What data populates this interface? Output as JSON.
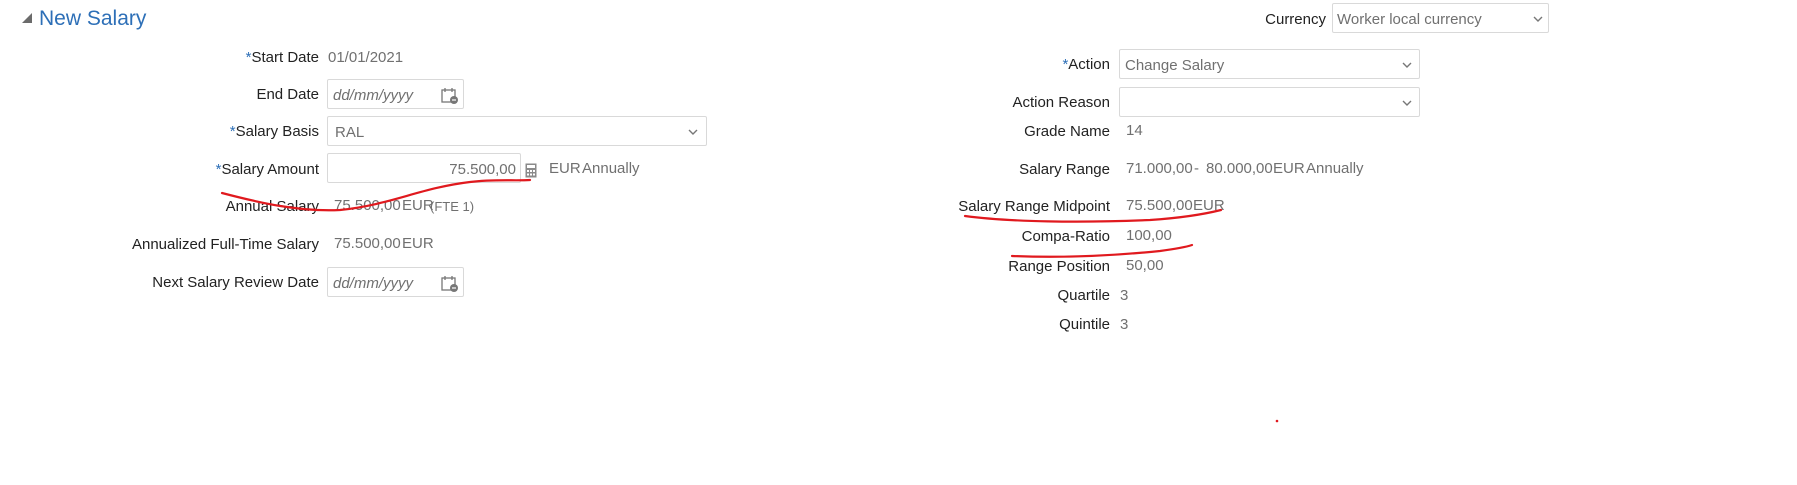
{
  "header": {
    "title": "New Salary",
    "currency_label": "Currency",
    "currency_value": "Worker local currency"
  },
  "left": {
    "start_date": {
      "label": "Start Date",
      "value": "01/01/2021"
    },
    "end_date": {
      "label": "End Date",
      "placeholder": "dd/mm/yyyy"
    },
    "salary_basis": {
      "label": "Salary Basis",
      "value": "RAL"
    },
    "salary_amount": {
      "label": "Salary Amount",
      "value": "75.500,00",
      "currency": "EUR",
      "frequency": "Annually"
    },
    "annual_salary": {
      "label": "Annual Salary",
      "value": "75.500,00",
      "currency": "EUR",
      "fte": "(FTE 1)"
    },
    "annualized": {
      "label": "Annualized Full-Time Salary",
      "value": "75.500,00",
      "currency": "EUR"
    },
    "next_review": {
      "label": "Next Salary Review Date",
      "placeholder": "dd/mm/yyyy"
    }
  },
  "right": {
    "action": {
      "label": "Action",
      "value": "Change Salary"
    },
    "action_reason": {
      "label": "Action Reason",
      "value": ""
    },
    "grade_name": {
      "label": "Grade Name",
      "value": "14"
    },
    "salary_range": {
      "label": "Salary Range",
      "min": "71.000,00",
      "sep": "-",
      "max": "80.000,00",
      "currency": "EUR",
      "frequency": "Annually"
    },
    "midpoint": {
      "label": "Salary Range Midpoint",
      "value": "75.500,00",
      "currency": "EUR"
    },
    "compa_ratio": {
      "label": "Compa-Ratio",
      "value": "100,00"
    },
    "range_position": {
      "label": "Range Position",
      "value": "50,00"
    },
    "quartile": {
      "label": "Quartile",
      "value": "3"
    },
    "quintile": {
      "label": "Quintile",
      "value": "3"
    }
  },
  "required_marker": "*",
  "icons": {
    "collapse": "triangle-collapse-icon",
    "calendar": "calendar-icon",
    "calculator": "calculator-icon",
    "dropdown": "chevron-down-icon"
  },
  "colors": {
    "accent": "#2d6fb7",
    "annotation": "#e0191e"
  }
}
